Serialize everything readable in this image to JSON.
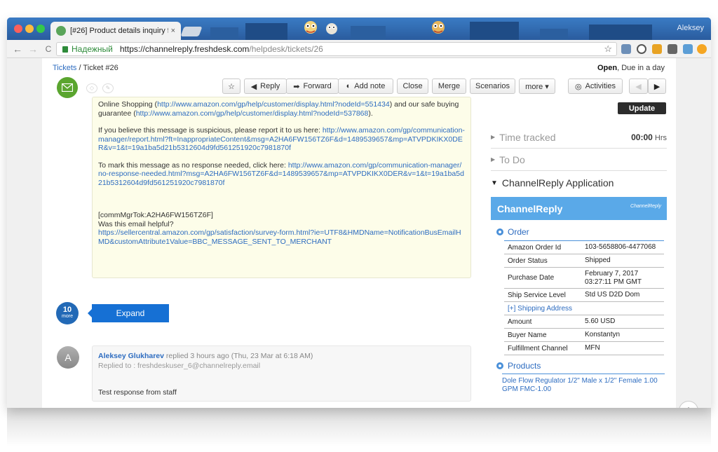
{
  "browser": {
    "tab_title": "[#26] Product details inquiry f",
    "tab_close": "×",
    "user": "Aleksey",
    "back": "←",
    "forward": "→",
    "reload": "C",
    "secure_label": "Надежный",
    "url_host": "https://channelreply.freshdesk.com",
    "url_path": "/helpdesk/tickets/26",
    "star": "☆"
  },
  "ticket": {
    "breadcrumb_root": "Tickets",
    "breadcrumb_sep": " / ",
    "breadcrumb_current": "Ticket #26",
    "status": "Open",
    "due": ", Due in a day"
  },
  "toolbar": {
    "star": "☆",
    "reply": "Reply",
    "forward": "Forward",
    "add_note": "Add note",
    "close": "Close",
    "merge": "Merge",
    "scenarios": "Scenarios",
    "more": "more ▾",
    "activities": "Activities",
    "prev": "◀",
    "next": "▶"
  },
  "email": {
    "p1_text_a": "Online Shopping (",
    "p1_link1": "http://www.amazon.com/gp/help/customer/display.html?nodeId=551434",
    "p1_text_b": ") and our safe buying guarantee (",
    "p1_link2": "http://www.amazon.com/gp/help/customer/display.html?nodeId=537868",
    "p1_text_c": ").",
    "p2_text": "If you believe this message is suspicious, please report it to us here: ",
    "p2_link": "http://www.amazon.com/gp/communication-manager/report.html?ft=InappropriateContent&msg=A2HA6FW156TZ6F&d=1489539657&mp=ATVPDKIKX0DER&v=1&t=19a1ba5d21b5312604d9fd561251920c7981870f",
    "p3_text": "To mark this message as no response needed, click here: ",
    "p3_link": "http://www.amazon.com/gp/communication-manager/no-response-needed.html?msg=A2HA6FW156TZ6F&d=1489539657&mp=ATVPDKIKX0DER&v=1&t=19a1ba5d21b5312604d9fd561251920c7981870f",
    "comm_tok": "[commMgrTok:A2HA6FW156TZ6F]",
    "helpful": "Was this email helpful?",
    "survey_link": "https://sellercentral.amazon.com/gp/satisfaction/survey-form.html?ie=UTF8&HMDName=NotificationBusEmailHMD&customAttribute1Value=BBC_MESSAGE_SENT_TO_MERCHANT"
  },
  "collapsed": {
    "count": "10",
    "more": "more",
    "expand_label": "Expand"
  },
  "reply": {
    "avatar_letter": "A",
    "author": "Aleksey Glukharev",
    "meta": " replied 3 hours ago (Thu, 23 Mar at 6:18 AM)",
    "replied_to": "Replied to : freshdeskuser_6@channelreply.email",
    "body": "Test response from staff"
  },
  "sidebar": {
    "update_label": "Update",
    "time_tracked_label": "Time tracked",
    "time_tracked_value": "00:00",
    "time_tracked_unit": " Hrs",
    "todo_label": "To Do",
    "app_label": "ChannelReply Application",
    "banner_title": "ChannelReply",
    "banner_logo": "ChannelReply",
    "order_header": "Order",
    "order_rows": [
      {
        "k": "Amazon Order Id",
        "v": "103-5658806-4477068"
      },
      {
        "k": "Order Status",
        "v": "Shipped"
      },
      {
        "k": "Purchase Date",
        "v": "February 7, 2017 03:27:11 PM GMT"
      },
      {
        "k": "Ship Service Level",
        "v": "Std US D2D Dom"
      },
      {
        "k": "[+]  Shipping Address",
        "v": ""
      },
      {
        "k": "Amount",
        "v": "5.60 USD"
      },
      {
        "k": "Buyer Name",
        "v": "Konstantyn"
      },
      {
        "k": "Fulfillment Channel",
        "v": "MFN"
      }
    ],
    "products_header": "Products",
    "product_line": "Dole Flow Regulator 1/2\" Male x 1/2\" Female 1.00 GPM FMC-1.00"
  },
  "scroll_top": "^",
  "colors": {
    "brand_blue": "#2d6cc0",
    "expand_blue": "#1670d4",
    "green": "#5aa52f",
    "banner": "#5aa9e8"
  }
}
